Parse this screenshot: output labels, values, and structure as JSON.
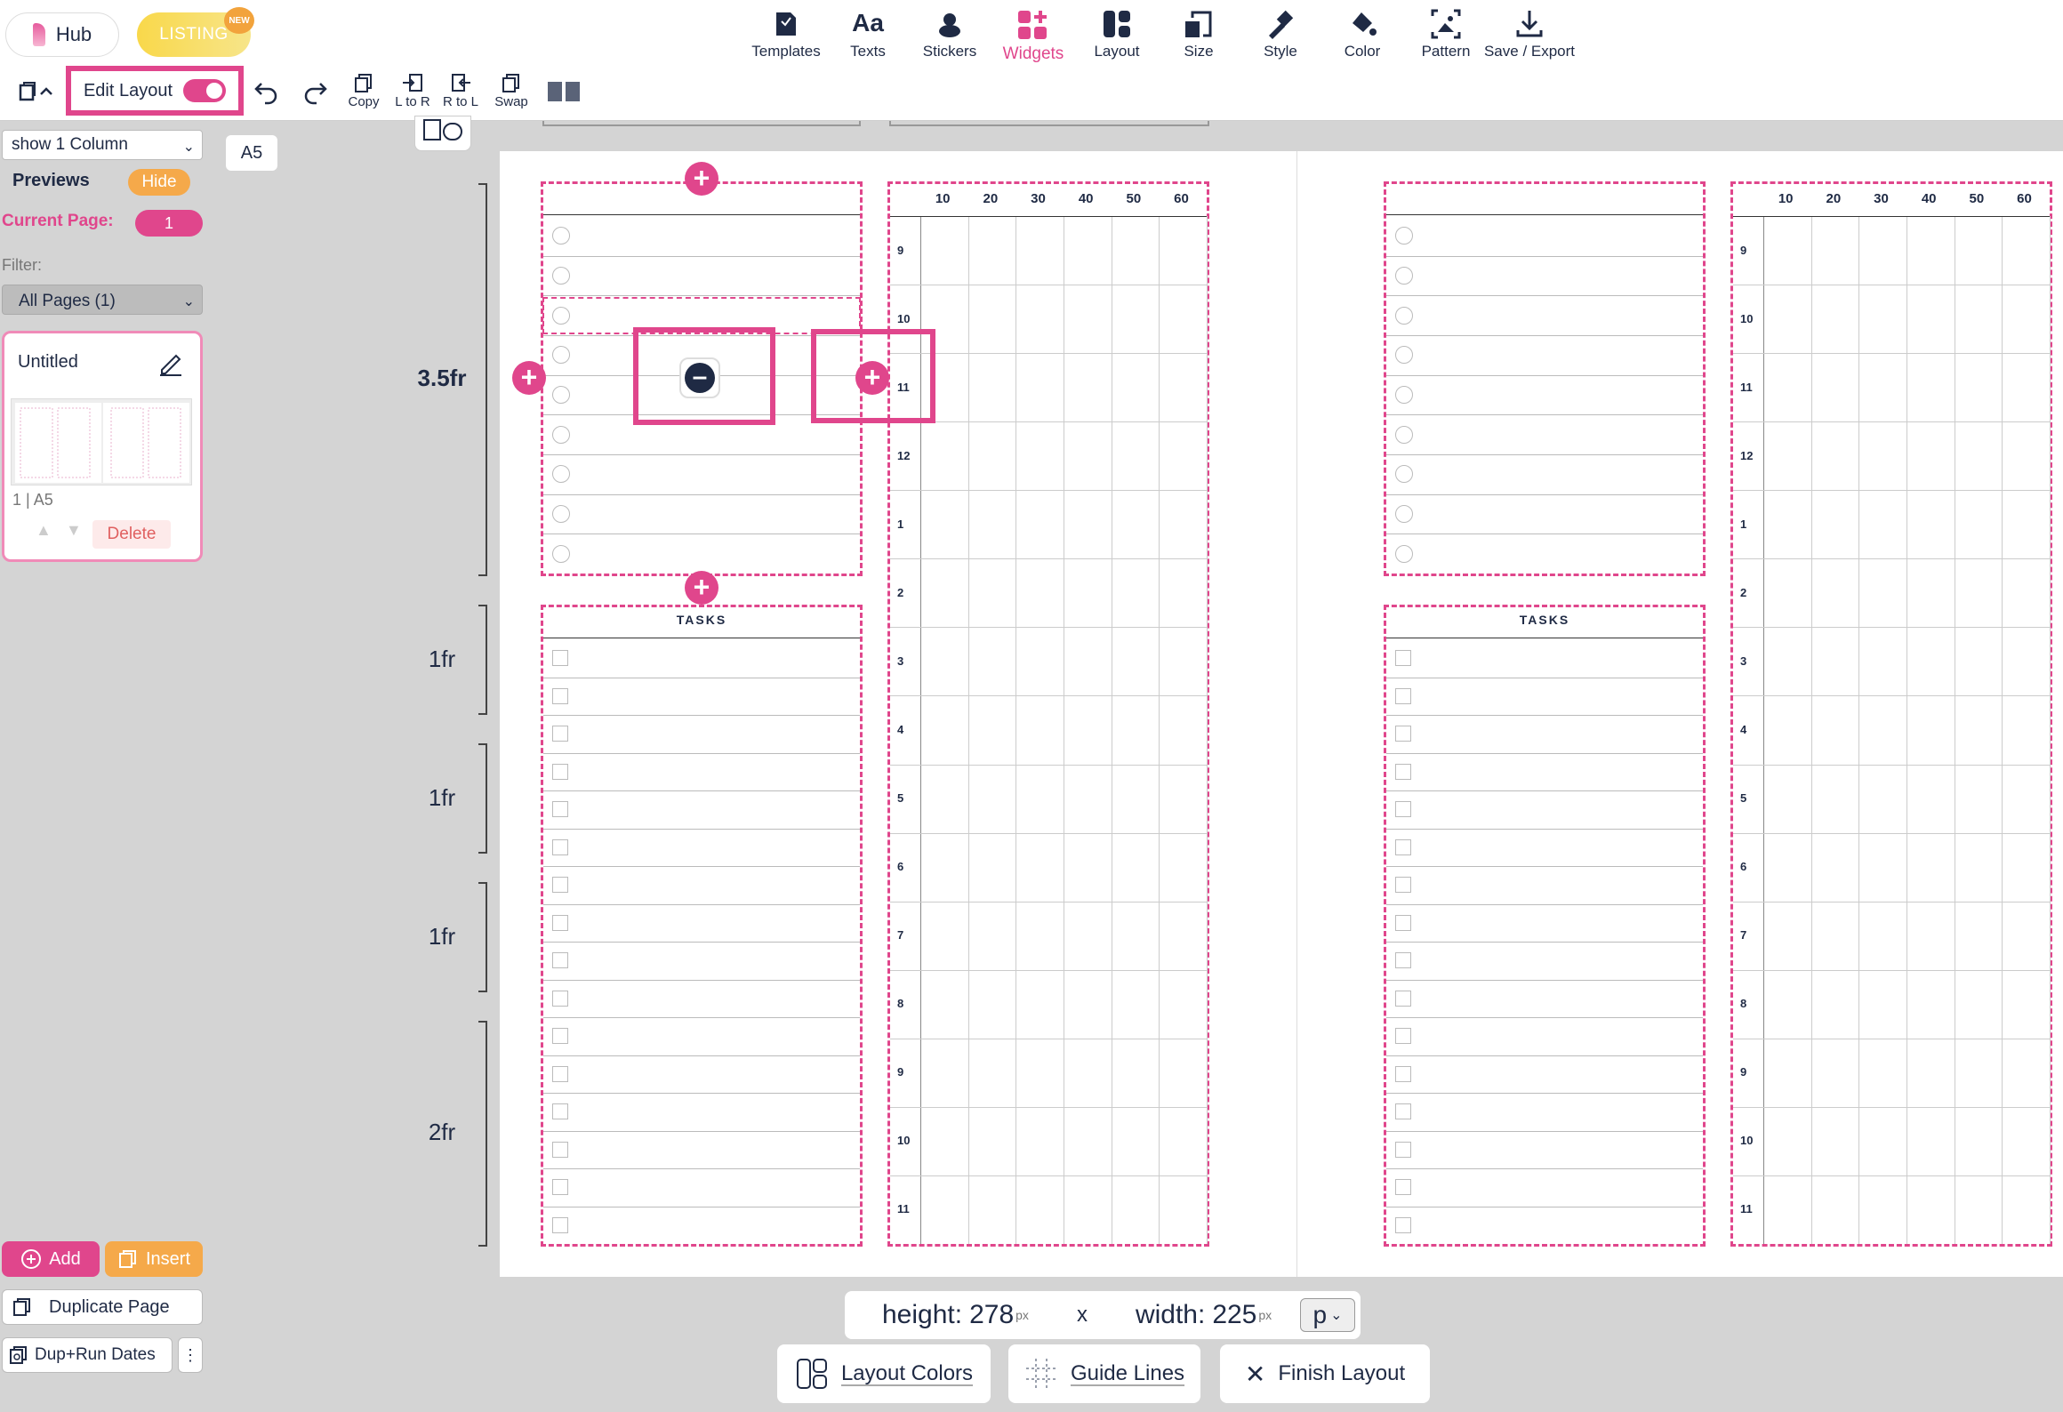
{
  "topbar": {
    "hub_label": "Hub",
    "listing_label": "LISTING",
    "new_badge": "NEW",
    "tools": [
      {
        "label": "Templates",
        "icon": "templates-icon"
      },
      {
        "label": "Texts",
        "icon": "texts-icon"
      },
      {
        "label": "Stickers",
        "icon": "stickers-icon"
      },
      {
        "label": "Widgets",
        "icon": "widgets-icon"
      },
      {
        "label": "Layout",
        "icon": "layout-icon"
      },
      {
        "label": "Size",
        "icon": "size-icon"
      },
      {
        "label": "Style",
        "icon": "style-icon"
      },
      {
        "label": "Color",
        "icon": "color-icon"
      },
      {
        "label": "Pattern",
        "icon": "pattern-icon"
      },
      {
        "label": "Save / Export",
        "icon": "save-export-icon"
      }
    ],
    "texts_glyph": "Aa",
    "active_color": "#e0468c"
  },
  "toolbar2": {
    "edit_layout_label": "Edit Layout",
    "copy_label": "Copy",
    "ltor_label": "L to R",
    "rtol_label": "R to L",
    "swap_label": "Swap"
  },
  "sidebar": {
    "show_columns": "show 1 Column",
    "previews_label": "Previews",
    "hide_label": "Hide",
    "current_page_label": "Current Page:",
    "current_page_value": "1",
    "filter_label": "Filter:",
    "filter_value": "All Pages (1)",
    "page_card": {
      "name": "Untitled",
      "meta": "1 | A5",
      "delete_label": "Delete"
    },
    "add_label": "Add",
    "insert_label": "Insert",
    "duplicate_label": "Duplicate Page",
    "dup_run_label": "Dup+Run Dates",
    "more_label": "⋮"
  },
  "canvas": {
    "size_label": "A5",
    "fr_labels": [
      "3.5fr",
      "1fr",
      "1fr",
      "1fr",
      "2fr"
    ],
    "tasks_title": "TASKS",
    "minute_headers": [
      "10",
      "20",
      "30",
      "40",
      "50",
      "60"
    ],
    "hours": [
      "9",
      "10",
      "11",
      "12",
      "1",
      "2",
      "3",
      "4",
      "5",
      "6",
      "7",
      "8",
      "9",
      "10",
      "11"
    ]
  },
  "bottom": {
    "height_label": "height:",
    "height_value": "278",
    "width_label": "width:",
    "width_value": "225",
    "unit_px": "px",
    "times": "x",
    "unit_select": "p",
    "layout_colors": "Layout Colors",
    "guide_lines": "Guide Lines",
    "finish_layout": "Finish Layout"
  }
}
